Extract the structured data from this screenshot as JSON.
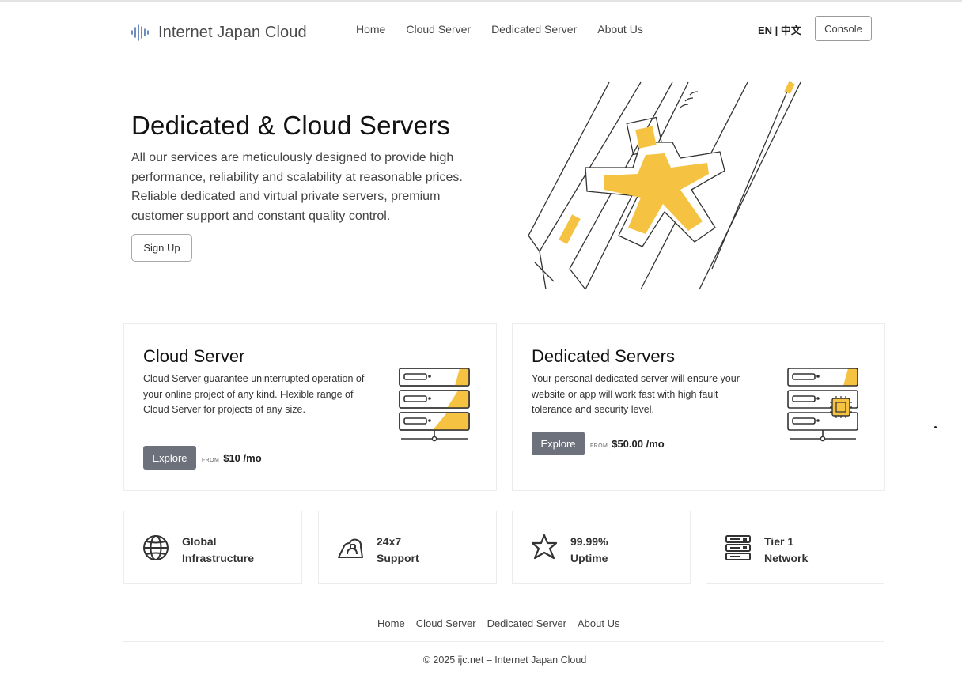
{
  "header": {
    "logo_text": "Internet Japan Cloud",
    "nav": [
      "Home",
      "Cloud Server",
      "Dedicated Server",
      "About Us"
    ],
    "lang": "EN | 中文",
    "console_label": "Console"
  },
  "hero": {
    "title": "Dedicated & Cloud Servers",
    "text": "All our services are meticulously designed to provide high performance, reliability and scalability at reasonable prices. Reliable dedicated and virtual private servers, premium customer support and constant quality control.",
    "signup_label": "Sign Up"
  },
  "cards": [
    {
      "title": "Cloud Server",
      "text": "Cloud Server guarantee uninterrupted operation of your online project of any kind. Flexible range of Cloud Server for projects of any size.",
      "explore_label": "Explore",
      "from_label": "FROM",
      "price": "$10 /mo"
    },
    {
      "title": "Dedicated Servers",
      "text": "Your personal dedicated server will ensure your website or app will work fast with high fault tolerance and security level.",
      "explore_label": "Explore",
      "from_label": "FROM",
      "price": "$50.00 /mo"
    }
  ],
  "features": [
    {
      "line1": "Global",
      "line2": "Infrastructure",
      "icon": "globe-icon"
    },
    {
      "line1": "24x7",
      "line2": "Support",
      "icon": "support-cloud-icon"
    },
    {
      "line1": "99.99%",
      "line2": "Uptime",
      "icon": "star-person-icon"
    },
    {
      "line1": "Tier 1",
      "line2": "Network",
      "icon": "network-server-icon"
    }
  ],
  "footer": {
    "nav": [
      "Home",
      "Cloud Server",
      "Dedicated Server",
      "About Us"
    ],
    "copyright": "© 2025 ijc.net – Internet Japan Cloud"
  },
  "colors": {
    "accent": "#f5c242",
    "button_gray": "#6c717b",
    "border": "#ececec"
  }
}
